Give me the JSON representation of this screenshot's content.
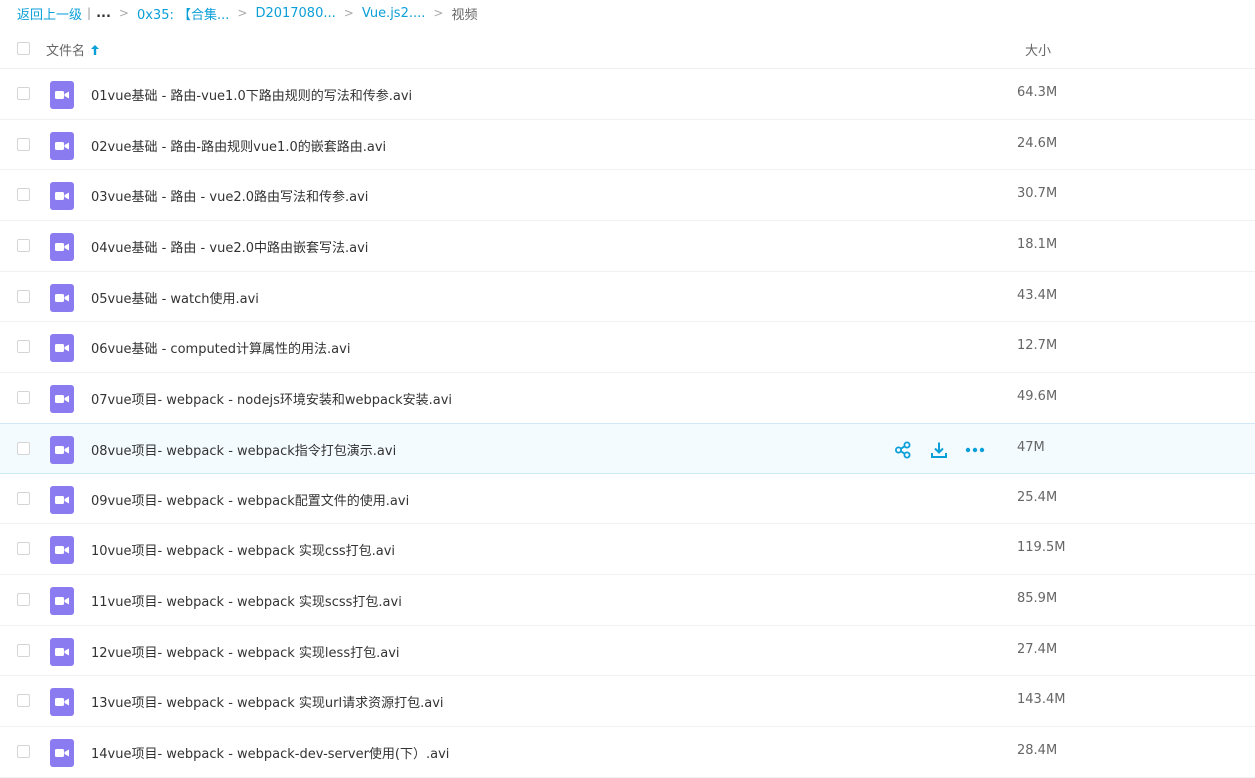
{
  "breadcrumb": {
    "back": "返回上一级",
    "ellipsis": "...",
    "items": [
      "0x35: 【合集...",
      "D2017080...",
      "Vue.js2...."
    ],
    "current": "视频"
  },
  "header": {
    "name_label": "文件名",
    "size_label": "大小"
  },
  "colors": {
    "link": "#0b9fd8",
    "video_icon": "#8a7cf0",
    "row_hover": "#f4fbff"
  },
  "files": [
    {
      "name": "01vue基础 - 路由-vue1.0下路由规则的写法和传参.avi",
      "size": "64.3M"
    },
    {
      "name": "02vue基础 - 路由-路由规则vue1.0的嵌套路由.avi",
      "size": "24.6M"
    },
    {
      "name": "03vue基础 - 路由 - vue2.0路由写法和传参.avi",
      "size": "30.7M"
    },
    {
      "name": "04vue基础 - 路由 - vue2.0中路由嵌套写法.avi",
      "size": "18.1M"
    },
    {
      "name": "05vue基础 - watch使用.avi",
      "size": "43.4M"
    },
    {
      "name": "06vue基础 - computed计算属性的用法.avi",
      "size": "12.7M"
    },
    {
      "name": "07vue项目- webpack - nodejs环境安装和webpack安装.avi",
      "size": "49.6M"
    },
    {
      "name": "08vue项目- webpack - webpack指令打包演示.avi",
      "size": "47M"
    },
    {
      "name": "09vue项目- webpack - webpack配置文件的使用.avi",
      "size": "25.4M"
    },
    {
      "name": "10vue项目- webpack - webpack 实现css打包.avi",
      "size": "119.5M"
    },
    {
      "name": "11vue项目- webpack - webpack 实现scss打包.avi",
      "size": "85.9M"
    },
    {
      "name": "12vue项目- webpack - webpack 实现less打包.avi",
      "size": "27.4M"
    },
    {
      "name": "13vue项目- webpack - webpack 实现url请求资源打包.avi",
      "size": "143.4M"
    },
    {
      "name": "14vue项目- webpack - webpack-dev-server使用(下）.avi",
      "size": "28.4M"
    }
  ],
  "hover_actions": {
    "icons": [
      "share-icon",
      "download-icon",
      "more-icon"
    ]
  }
}
